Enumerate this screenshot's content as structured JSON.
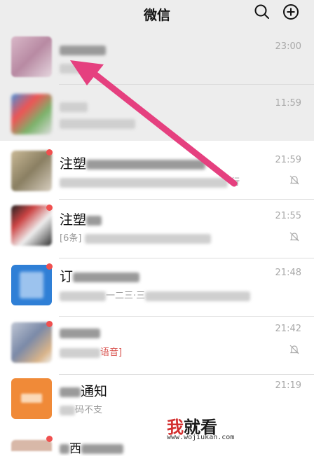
{
  "header": {
    "title": "微信",
    "search_icon": "search-icon",
    "add_icon": "plus-circle-icon",
    "background": "#ededed"
  },
  "chats": [
    {
      "name": "",
      "preview": "",
      "time": "23:00",
      "pinned": true,
      "muted": false,
      "unread_dot": false
    },
    {
      "name": "",
      "preview": "",
      "time": "11:59",
      "pinned": true,
      "muted": false,
      "unread_dot": false
    },
    {
      "name": "注塑",
      "preview": "行",
      "time": "21:59",
      "pinned": false,
      "muted": true,
      "unread_dot": true
    },
    {
      "name": "注塑",
      "preview": "[6条]",
      "time": "21:55",
      "pinned": false,
      "muted": true,
      "unread_dot": true
    },
    {
      "name": "订",
      "preview": "一二三·三",
      "time": "21:48",
      "pinned": false,
      "muted": false,
      "unread_dot": true
    },
    {
      "name": "",
      "preview": "语音]",
      "time": "21:42",
      "pinned": false,
      "muted": true,
      "unread_dot": true
    },
    {
      "name": "通知",
      "preview": "码不支",
      "time": "21:19",
      "pinned": false,
      "muted": false,
      "unread_dot": false
    },
    {
      "name": "西",
      "preview": "",
      "time": "",
      "pinned": false,
      "muted": false,
      "unread_dot": true
    }
  ],
  "watermark": {
    "line1a": "我",
    "line1b": "就看",
    "line2": "www.wojiukan.com"
  },
  "colors": {
    "arrow": "#e5407f",
    "badge": "#f0504f",
    "time": "#a9a9a9"
  }
}
